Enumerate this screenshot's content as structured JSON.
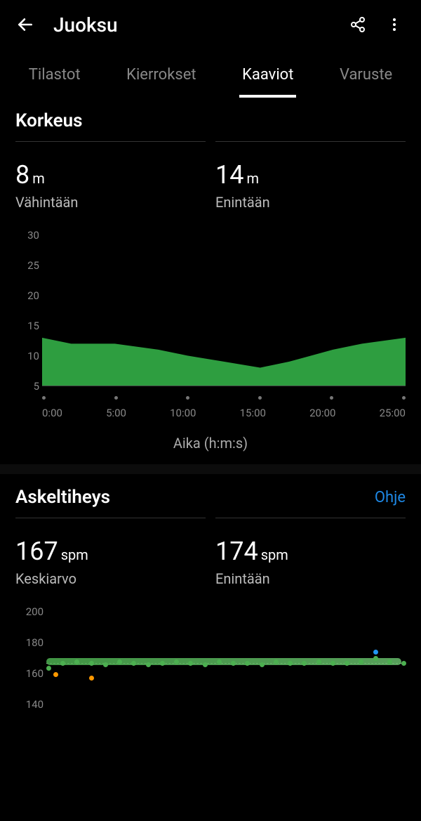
{
  "header": {
    "title": "Juoksu"
  },
  "tabs": [
    {
      "label": "Tilastot",
      "active": false
    },
    {
      "label": "Kierrokset",
      "active": false
    },
    {
      "label": "Kaaviot",
      "active": true
    },
    {
      "label": "Varuste",
      "active": false
    }
  ],
  "elevation": {
    "title": "Korkeus",
    "min": {
      "value": "8",
      "unit": "m",
      "label": "Vähintään"
    },
    "max": {
      "value": "14",
      "unit": "m",
      "label": "Enintään"
    },
    "axis_label": "Aika (h:m:s)"
  },
  "cadence": {
    "title": "Askeltiheys",
    "help": "Ohje",
    "avg": {
      "value": "167",
      "unit": "spm",
      "label": "Keskiarvo"
    },
    "max": {
      "value": "174",
      "unit": "spm",
      "label": "Enintään"
    }
  },
  "chart_data": [
    {
      "type": "area",
      "title": "Korkeus",
      "xlabel": "Aika (h:m:s)",
      "ylabel": "m",
      "ylim": [
        5,
        30
      ],
      "x_ticks": [
        "0:00",
        "5:00",
        "10:00",
        "15:00",
        "20:00",
        "25:00"
      ],
      "y_ticks": [
        30,
        25,
        20,
        15,
        10,
        5
      ],
      "x": [
        0,
        2,
        5,
        8,
        10,
        12.5,
        15,
        17,
        20,
        22,
        25
      ],
      "values": [
        13,
        12,
        12,
        11,
        10,
        9,
        8,
        9,
        11,
        12,
        13
      ],
      "color": "#2e9e40"
    },
    {
      "type": "scatter",
      "title": "Askeltiheys",
      "ylabel": "spm",
      "ylim": [
        140,
        200
      ],
      "y_ticks": [
        200,
        180,
        160,
        140
      ],
      "reference_line": 167,
      "x": [
        0,
        1,
        2,
        3,
        4,
        5,
        6,
        7,
        8,
        9,
        10,
        11,
        12,
        13,
        14,
        15,
        16,
        17,
        18,
        19,
        20,
        21,
        22,
        23,
        24,
        25
      ],
      "values": [
        164,
        167,
        168,
        167,
        166,
        168,
        167,
        166,
        167,
        168,
        167,
        166,
        168,
        167,
        167,
        166,
        168,
        167,
        167,
        168,
        167,
        167,
        168,
        170,
        168,
        167
      ],
      "outliers": [
        {
          "x": 0.5,
          "y": 160,
          "color": "#ff9800"
        },
        {
          "x": 3,
          "y": 158,
          "color": "#ff9800"
        },
        {
          "x": 23,
          "y": 174,
          "color": "#2196f3"
        }
      ],
      "color": "#4caf50"
    }
  ]
}
